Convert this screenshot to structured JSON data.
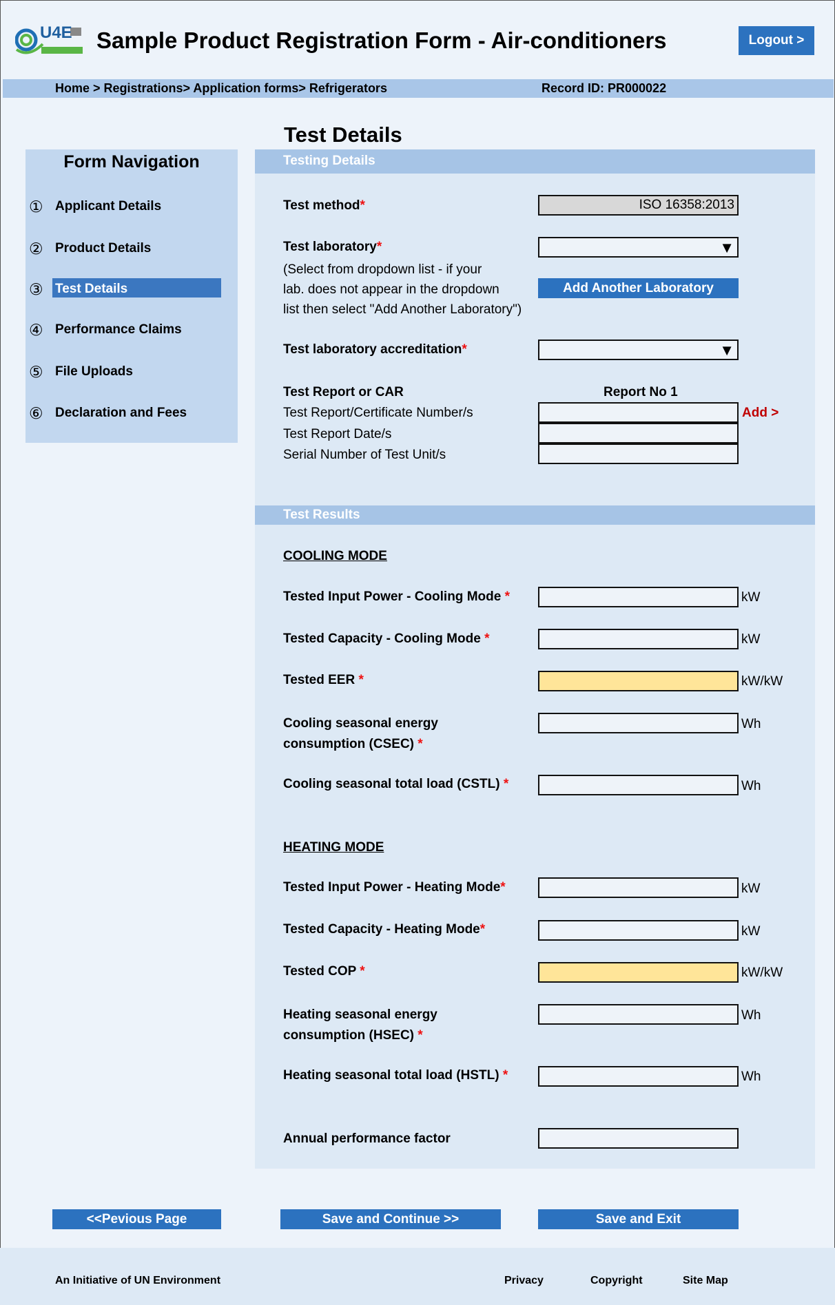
{
  "header": {
    "logo_text": "U4E",
    "title": "Sample Product Registration Form - Air-conditioners",
    "logout_label": "Logout >"
  },
  "breadcrumb": {
    "path": "Home > Registrations> Application forms> Refrigerators",
    "record_id": "Record ID: PR000022"
  },
  "nav": {
    "heading": "Form Navigation",
    "items": [
      {
        "num": "①",
        "label": "Applicant Details"
      },
      {
        "num": "②",
        "label": "Product Details"
      },
      {
        "num": "③",
        "label": "Test Details"
      },
      {
        "num": "④",
        "label": "Performance Claims"
      },
      {
        "num": "⑤",
        "label": "File Uploads"
      },
      {
        "num": "⑥",
        "label": "Declaration and Fees"
      }
    ]
  },
  "section_title": "Test Details",
  "testing": {
    "bar": "Testing Details",
    "method_label": "Test method",
    "method_value": "ISO 16358:2013",
    "lab_label": "Test laboratory",
    "lab_help_1": "(Select from dropdown list - if your",
    "lab_help_2": "lab. does not appear in the dropdown",
    "lab_help_3": "list then select \"Add Another Laboratory\")",
    "add_lab_button": "Add Another Laboratory",
    "accreditation_label": "Test laboratory accreditation",
    "report_heading": "Test Report or CAR",
    "report_col": "Report No 1",
    "cert_label": "Test Report/Certificate Number/s",
    "date_label": "Test Report Date/s",
    "serial_label": "Serial Number of Test Unit/s",
    "add_link": "Add >"
  },
  "results": {
    "bar": "Test Results",
    "cooling_heading": "COOLING MODE",
    "c_input": "Tested Input Power - Cooling Mode ",
    "c_capacity": "Tested Capacity - Cooling Mode ",
    "c_eer": "Tested EER ",
    "c_csec_1": "Cooling seasonal energy",
    "c_csec_2": "consumption (CSEC) ",
    "c_cstl": "Cooling seasonal total load (CSTL) ",
    "heating_heading": "HEATING MODE",
    "h_input": "Tested Input Power - Heating Mode",
    "h_capacity": "Tested Capacity - Heating Mode",
    "h_cop": "Tested COP ",
    "h_hsec_1": "Heating seasonal energy",
    "h_hsec_2": "consumption (HSEC) ",
    "h_hstl": "Heating seasonal total load (HSTL) ",
    "apf": "Annual performance factor",
    "units": {
      "kw": "kW",
      "kwkw": "kW/kW",
      "wh": "Wh"
    },
    "required": "*"
  },
  "buttons": {
    "previous": "<<Pevious Page",
    "save_continue": "Save and Continue >>",
    "save_exit": "Save and Exit"
  },
  "footer": {
    "initiative": "An Initiative of UN Environment",
    "privacy": "Privacy",
    "copyright": "Copyright",
    "sitemap": "Site Map"
  }
}
